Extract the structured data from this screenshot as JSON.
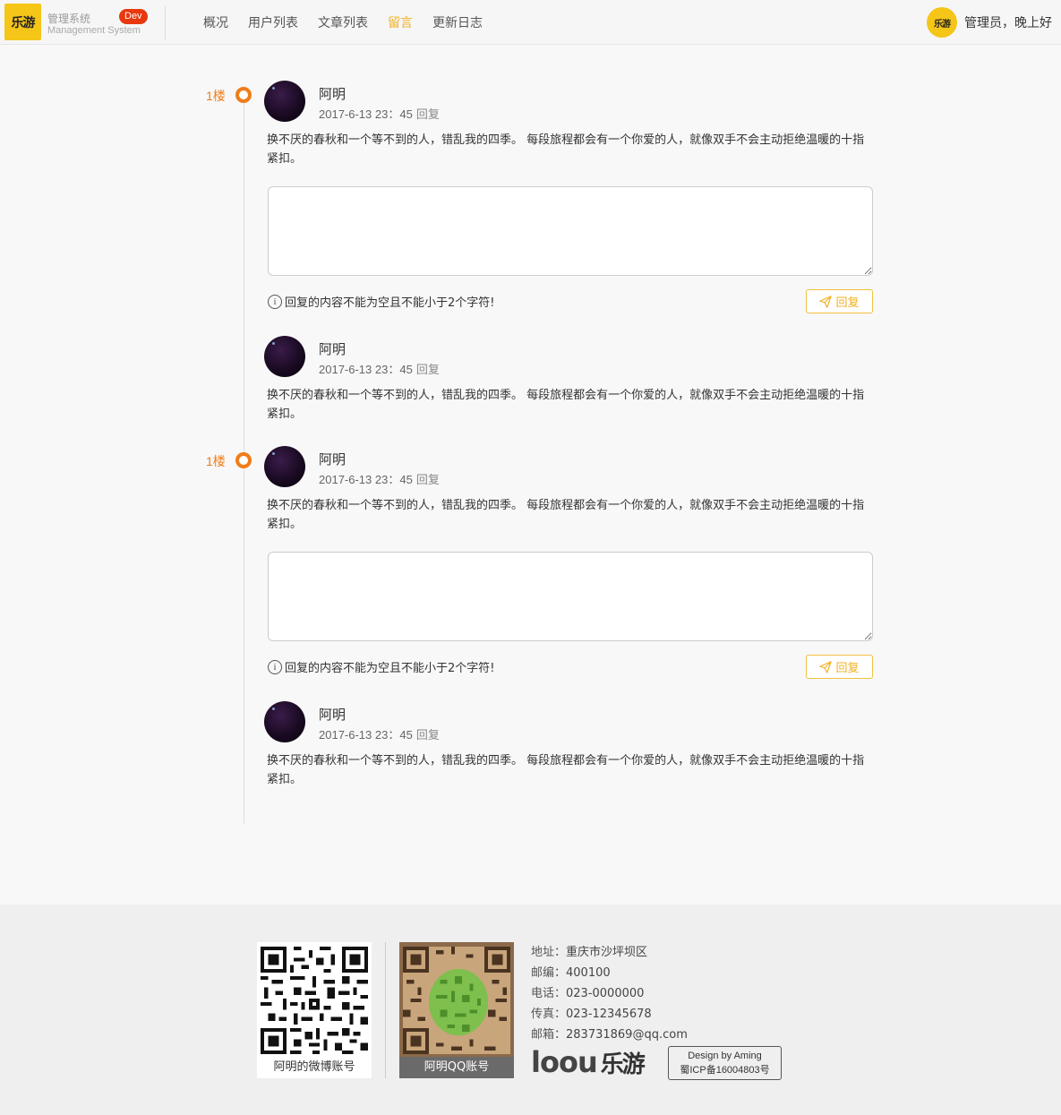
{
  "header": {
    "logo_text": "乐游",
    "system_cn": "管理系统",
    "system_en": "Management System",
    "badge": "Dev",
    "nav": [
      {
        "label": "概况",
        "active": false
      },
      {
        "label": "用户列表",
        "active": false
      },
      {
        "label": "文章列表",
        "active": false
      },
      {
        "label": "留言",
        "active": true
      },
      {
        "label": "更新日志",
        "active": false
      }
    ],
    "user_avatar_text": "乐游",
    "greeting": "管理员，晚上好"
  },
  "messages": [
    {
      "floor": "1楼",
      "name": "阿明",
      "time": "2017-6-13 23：45",
      "reply_label": "回复",
      "content": "换不厌的春秋和一个等不到的人，错乱我的四季。 每段旅程都会有一个你爱的人，就像双手不会主动拒绝温暖的十指紧扣。",
      "hint": "回复的内容不能为空且不能小于2个字符!",
      "button": "回复",
      "reply": {
        "name": "阿明",
        "time": "2017-6-13 23：45",
        "reply_label": "回复",
        "content": "换不厌的春秋和一个等不到的人，错乱我的四季。 每段旅程都会有一个你爱的人，就像双手不会主动拒绝温暖的十指紧扣。"
      }
    },
    {
      "floor": "1楼",
      "name": "阿明",
      "time": "2017-6-13 23：45",
      "reply_label": "回复",
      "content": "换不厌的春秋和一个等不到的人，错乱我的四季。 每段旅程都会有一个你爱的人，就像双手不会主动拒绝温暖的十指紧扣。",
      "hint": "回复的内容不能为空且不能小于2个字符!",
      "button": "回复",
      "reply": {
        "name": "阿明",
        "time": "2017-6-13 23：45",
        "reply_label": "回复",
        "content": "换不厌的春秋和一个等不到的人，错乱我的四季。 每段旅程都会有一个你爱的人，就像双手不会主动拒绝温暖的十指紧扣。"
      }
    }
  ],
  "footer": {
    "weibo_caption": "阿明的微博账号",
    "qq_caption": "阿明QQ账号",
    "info": [
      {
        "key": "地址：",
        "value": "重庆市沙坪坝区"
      },
      {
        "key": "邮编：",
        "value": "400100"
      },
      {
        "key": "电话：",
        "value": "023-0000000"
      },
      {
        "key": "传真：",
        "value": "023-12345678"
      },
      {
        "key": "邮箱：",
        "value": "283731869@qq.com"
      }
    ],
    "brand_en": "loou",
    "brand_cn": "乐游",
    "design_by": "Design by Aming",
    "icp": "蜀ICP备16004803号"
  },
  "colors": {
    "accent": "#f0b020",
    "timeline": "#ef7d1a",
    "badge": "#e8380d"
  }
}
